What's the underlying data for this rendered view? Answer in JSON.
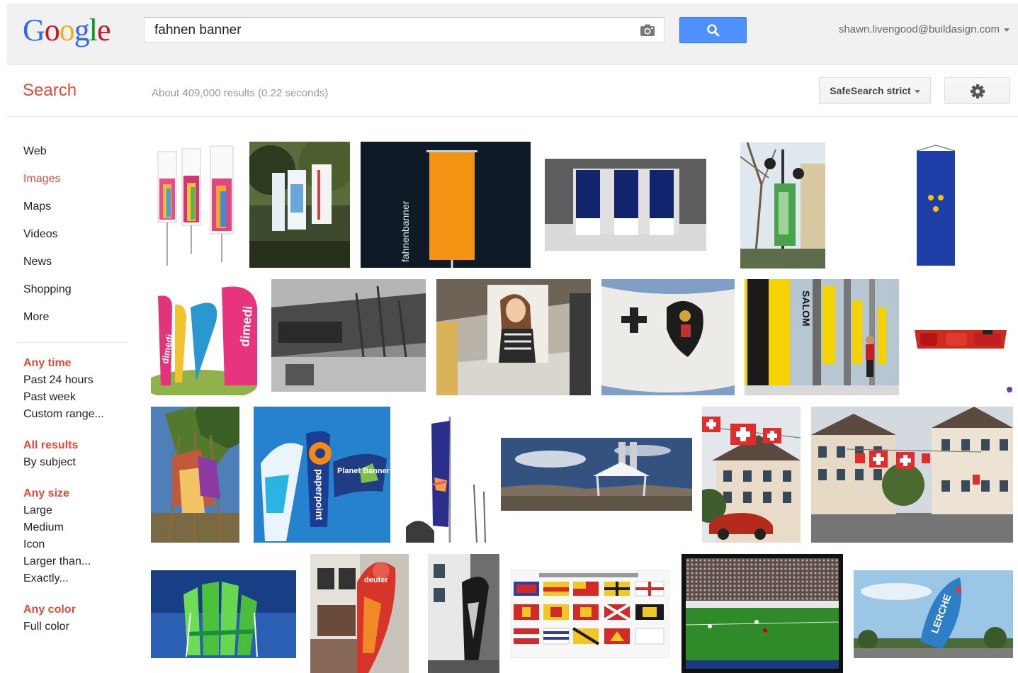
{
  "header": {
    "logo_letters": [
      "G",
      "o",
      "o",
      "g",
      "l",
      "e"
    ],
    "search_query": "fahnen banner",
    "account_email": "shawn.livengood@buildasign.com"
  },
  "subbar": {
    "section_label": "Search",
    "result_stats": "About 409,000 results (0.22 seconds)",
    "safesearch_label": "SafeSearch strict"
  },
  "nav": {
    "items": [
      {
        "label": "Web"
      },
      {
        "label": "Images"
      },
      {
        "label": "Maps"
      },
      {
        "label": "Videos"
      },
      {
        "label": "News"
      },
      {
        "label": "Shopping"
      },
      {
        "label": "More"
      }
    ]
  },
  "filters": {
    "time": {
      "heading": "Any time",
      "options": [
        "Past 24 hours",
        "Past week",
        "Custom range..."
      ]
    },
    "results": {
      "heading": "All results",
      "options": [
        "By subject"
      ]
    },
    "size": {
      "heading": "Any size",
      "options": [
        "Large",
        "Medium",
        "Icon",
        "Larger than...",
        "Exactly..."
      ]
    },
    "color": {
      "heading": "Any color",
      "options": [
        "Full color"
      ]
    }
  },
  "thumb_texts": {
    "fahnenbanner": "fahnenbanner",
    "dimedi": "dimedi",
    "salomon": "SALOM",
    "paperpoint": "paperpoint",
    "planet": "Planet Banner",
    "lerche": "LERCHE",
    "deuter": "deuter"
  }
}
